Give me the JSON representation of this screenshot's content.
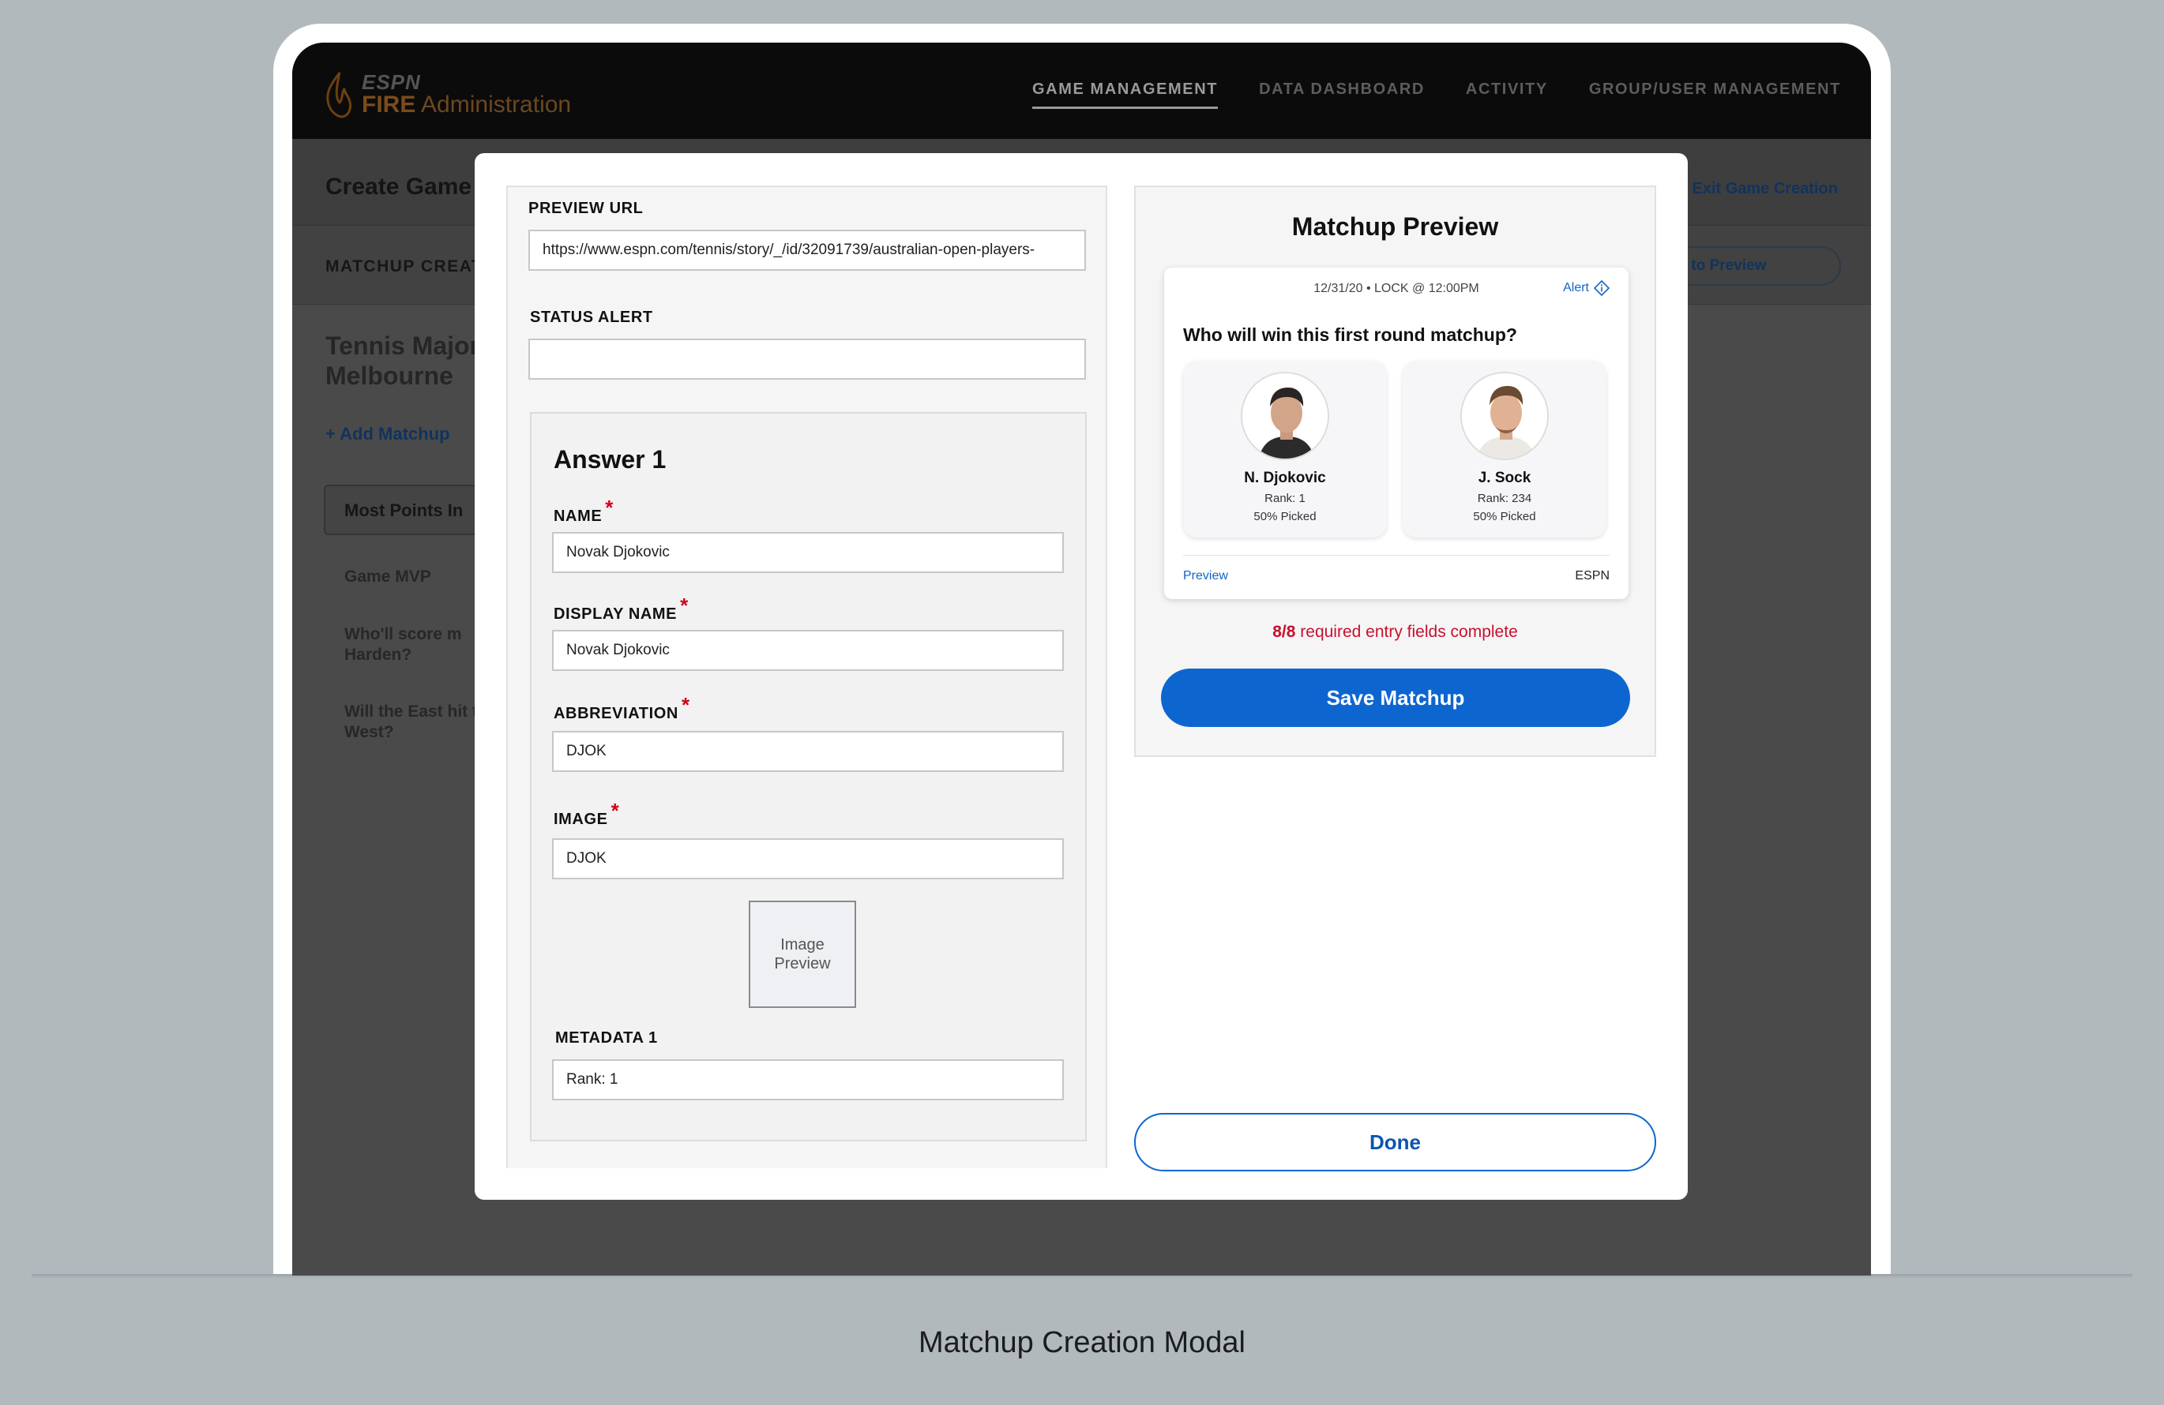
{
  "caption": "Matchup Creation Modal",
  "app": {
    "brand_top": "ESPN",
    "brand_fire": "FIRE",
    "brand_admin": "Administration",
    "nav": [
      {
        "label": "GAME MANAGEMENT",
        "active": true
      },
      {
        "label": "DATA DASHBOARD",
        "active": false
      },
      {
        "label": "ACTIVITY",
        "active": false
      },
      {
        "label": "GROUP/USER MANAGEMENT",
        "active": false
      }
    ],
    "page_title": "Create Game",
    "exit_label": "Exit Game Creation",
    "section_label": "MATCHUP CREAT",
    "continue_label": "e to Preview",
    "game_title": "Tennis Major Melbourne",
    "add_matchup": "+ Add Matchup",
    "active_tab": "Most Points In",
    "questions": [
      "Game MVP",
      "Who'll score m Harden?",
      "Will the East hit the West?"
    ]
  },
  "form": {
    "preview_url_label": "PREVIEW URL",
    "preview_url_value": "https://www.espn.com/tennis/story/_/id/32091739/australian-open-players-",
    "status_alert_label": "STATUS ALERT",
    "status_alert_value": "",
    "answer_title": "Answer 1",
    "name_label": "NAME",
    "name_value": "Novak Djokovic",
    "display_name_label": "DISPLAY NAME",
    "display_name_value": "Novak Djokovic",
    "abbreviation_label": "ABBREVIATION",
    "abbreviation_value": "DJOK",
    "image_label": "IMAGE",
    "image_value": "DJOK",
    "image_preview": "Image Preview",
    "metadata_label": "METADATA 1",
    "metadata_value": "Rank: 1",
    "required_mark": "*"
  },
  "preview": {
    "title": "Matchup Preview",
    "meta": "12/31/20 • LOCK @ 12:00PM",
    "alert_label": "Alert",
    "question": "Who will win this first round matchup?",
    "players": [
      {
        "name": "N. Djokovic",
        "rank": "Rank: 1",
        "picked": "50% Picked"
      },
      {
        "name": "J. Sock",
        "rank": "Rank: 234",
        "picked": "50% Picked"
      }
    ],
    "footer_left": "Preview",
    "footer_right": "ESPN",
    "completion_count": "8/8",
    "completion_text": "required entry fields complete",
    "save_label": "Save Matchup",
    "done_label": "Done"
  },
  "colors": {
    "accent": "#0d66d0",
    "required": "#d0021b",
    "brand": "#e87722"
  }
}
